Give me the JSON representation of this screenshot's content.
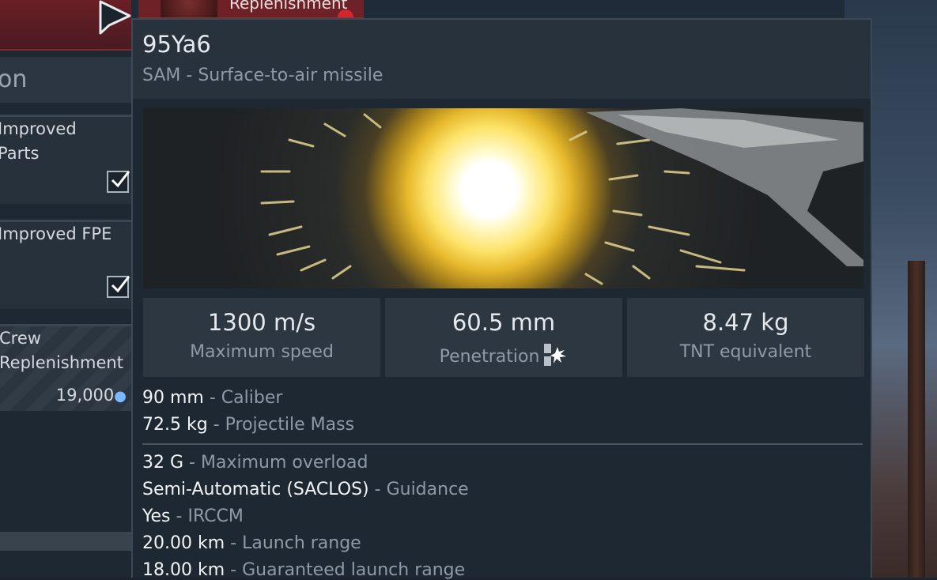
{
  "top_tab": {
    "label": "Replenishment"
  },
  "left_panel": {
    "section_title": "on",
    "modules": [
      {
        "label_lines": [
          "Improved",
          "Parts"
        ],
        "checked": true
      },
      {
        "label_lines": [
          "Improved FPE"
        ],
        "checked": true
      }
    ],
    "crew": {
      "label_lines": [
        "Crew",
        "Replenishment"
      ],
      "price": "19,000",
      "currency_icon": "lightbulb-icon"
    }
  },
  "tooltip": {
    "title": "95Ya6",
    "subtitle": "SAM - Surface-to-air missile",
    "image_alt": "missile-explosion-image",
    "stats": [
      {
        "value": "1300 m/s",
        "label": "Maximum speed"
      },
      {
        "value": "60.5 mm",
        "label": "Penetration",
        "icon": "penetration-icon"
      },
      {
        "value": "8.47 kg",
        "label": "TNT equivalent"
      }
    ],
    "properties_a": [
      {
        "value": "90 mm",
        "label": "Caliber"
      },
      {
        "value": "72.5 kg",
        "label": "Projectile Mass"
      }
    ],
    "properties_b": [
      {
        "value": "32 G",
        "label": "Maximum overload"
      },
      {
        "value": "Semi-Automatic (SACLOS)",
        "label": "Guidance"
      },
      {
        "value": "Yes",
        "label": "IRCCM"
      },
      {
        "value": "20.00 km",
        "label": "Launch range"
      },
      {
        "value": "18.00 km",
        "label": "Guaranteed launch range"
      }
    ],
    "separator": " - "
  },
  "colors": {
    "tooltip_bg": "#1e2832",
    "header_bg": "#27323d",
    "stat_bg": "#2c3742",
    "value_text": "#f2f4f6",
    "label_text": "#8e9aa6",
    "replenishment_red": "#6e2126"
  }
}
